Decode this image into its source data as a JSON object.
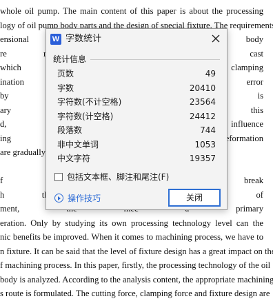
{
  "document": {
    "lines": [
      "whole oil pump. The main content of this paper is about the processing",
      "logy of oil pump body parts and the design of special fixture. The requirements",
      "ensional accu                                                              pump body",
      "re relatively h                                                           of gray cast",
      "which will proc                                                             clamping",
      "ination error of                                                          itable error",
      "by processin                                                              parts, it is",
      "ary to separat                                                          hrough this",
      "d, the machini                                                          e influence",
      "ing force and                                                           deformation",
      "are gradually                                                           ents of the",
      "",
      "f an enterprise                                                          ality, break",
      "h the bottlene                                                          ng level of",
      "ment, the mec                                                           a primary",
      "eration. Only by studying its own processing technology level can the",
      "nic benefits be improved. When it comes to machining process, we have to",
      "n fixture. It can be said that the level of fixture design has a great impact on the",
      "f machining process. In this paper, firstly, the processing technology of the oil",
      "body is analyzed. According to the analysis content, the appropriate machining",
      "s route is formulated. The cutting force, clamping force and fixture design are"
    ]
  },
  "dialog": {
    "app_icon_letter": "W",
    "title": "字数统计",
    "group_label": "统计信息",
    "stats": [
      {
        "label": "页数",
        "value": "49"
      },
      {
        "label": "字数",
        "value": "20410"
      },
      {
        "label": "字符数(不计空格)",
        "value": "23564"
      },
      {
        "label": "字符数(计空格)",
        "value": "24412"
      },
      {
        "label": "段落数",
        "value": "744"
      },
      {
        "label": "非中文单词",
        "value": "1053"
      },
      {
        "label": "中文字符",
        "value": "19357"
      }
    ],
    "checkbox_label": "包括文本框、脚注和尾注(F)",
    "checkbox_checked": false,
    "tips_label": "操作技巧",
    "close_button_label": "关闭"
  },
  "colors": {
    "accent": "#2f6fd3",
    "link": "#2a6ad6",
    "dialog_bg": "#f3f3f3"
  }
}
